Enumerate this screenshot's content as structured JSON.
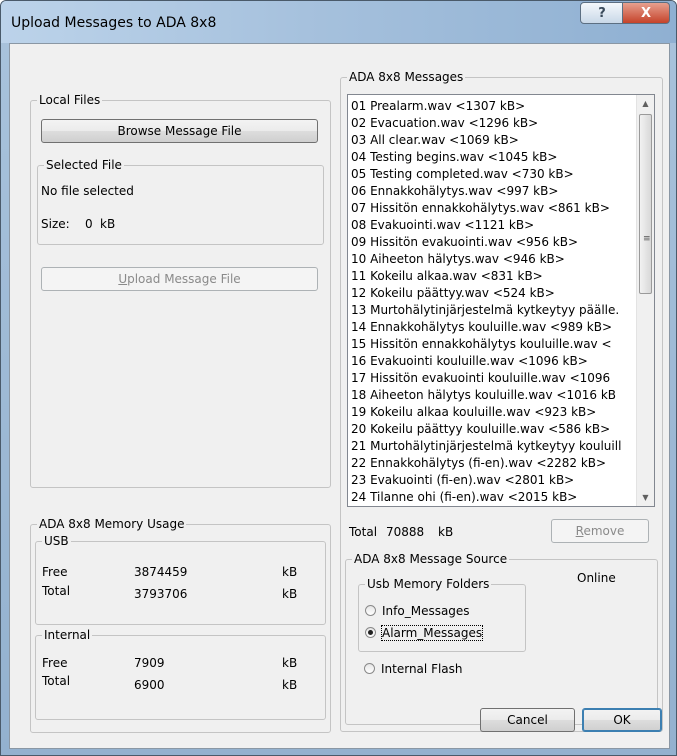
{
  "window": {
    "title": "Upload Messages to ADA 8x8",
    "help_glyph": "?",
    "close_glyph": "X"
  },
  "local_files": {
    "group_label": "Local Files",
    "browse_button": "Browse Message File",
    "selected_file": {
      "group_label": "Selected File",
      "name": "No file selected",
      "size_label": "Size:",
      "size_value": "0",
      "size_unit": "kB"
    },
    "upload_button_pre": "",
    "upload_button_mnemonic": "U",
    "upload_button_post": "pload Message File"
  },
  "memory_usage": {
    "group_label": "ADA 8x8 Memory Usage",
    "usb": {
      "group_label": "USB",
      "rows": [
        {
          "label": "Free",
          "value": "3874459",
          "unit": "kB"
        },
        {
          "label": "Total",
          "value": "3793706",
          "unit": "kB"
        }
      ]
    },
    "internal": {
      "group_label": "Internal",
      "rows": [
        {
          "label": "Free",
          "value": "7909",
          "unit": "kB"
        },
        {
          "label": "Total",
          "value": "6900",
          "unit": "kB"
        }
      ]
    }
  },
  "messages": {
    "group_label": "ADA 8x8 Messages",
    "items": [
      "01 Prealarm.wav <1307 kB>",
      "02 Evacuation.wav <1296 kB>",
      "03 All clear.wav <1069 kB>",
      "04 Testing begins.wav <1045 kB>",
      "05 Testing completed.wav <730 kB>",
      "06 Ennakkohälytys.wav <997 kB>",
      "07 Hissitön ennakkohälytys.wav <861 kB>",
      "08 Evakuointi.wav <1121 kB>",
      "09 Hissitön evakuointi.wav <956 kB>",
      "10 Aiheeton hälytys.wav <946 kB>",
      "11 Kokeilu alkaa.wav <831 kB>",
      "12 Kokeilu päättyy.wav <524 kB>",
      "13 Murtohälytinjärjestelmä kytkeytyy päälle.",
      "14 Ennakkohälytys kouluille.wav <989 kB>",
      "15 Hissitön ennakkohälytys kouluille.wav <",
      "16 Evakuointi kouluille.wav <1096 kB>",
      "17 Hissitön evakuointi kouluille.wav <1096",
      "18 Aiheeton hälytys kouluille.wav <1016 kB",
      "19 Kokeilu alkaa kouluille.wav <923 kB>",
      "20 Kokeilu päättyy kouluille.wav <586 kB>",
      "21 Murtohälytinjärjestelmä kytkeytyy kouluill",
      "22 Ennakkohälytys (fi-en).wav <2282 kB>",
      "23 Evakuointi (fi-en).wav <2801 kB>",
      "24 Tilanne ohi (fi-en).wav <2015 kB>"
    ],
    "total_label": "Total",
    "total_value": "70888",
    "total_unit": "kB",
    "remove_mnemonic": "R",
    "remove_rest": "emove",
    "scroll_up_glyph": "▲",
    "scroll_down_glyph": "▼",
    "scroll_grip_glyph": "≡"
  },
  "message_source": {
    "group_label": "ADA 8x8 Message Source",
    "status": "Online",
    "usb_folders_label": "Usb Memory Folders",
    "options": [
      {
        "label": "Info_Messages",
        "checked": false
      },
      {
        "label": "Alarm_Messages",
        "checked": true
      },
      {
        "label": "Internal Flash",
        "checked": false
      }
    ]
  },
  "footer": {
    "cancel_button": "Cancel",
    "ok_button": "OK"
  }
}
